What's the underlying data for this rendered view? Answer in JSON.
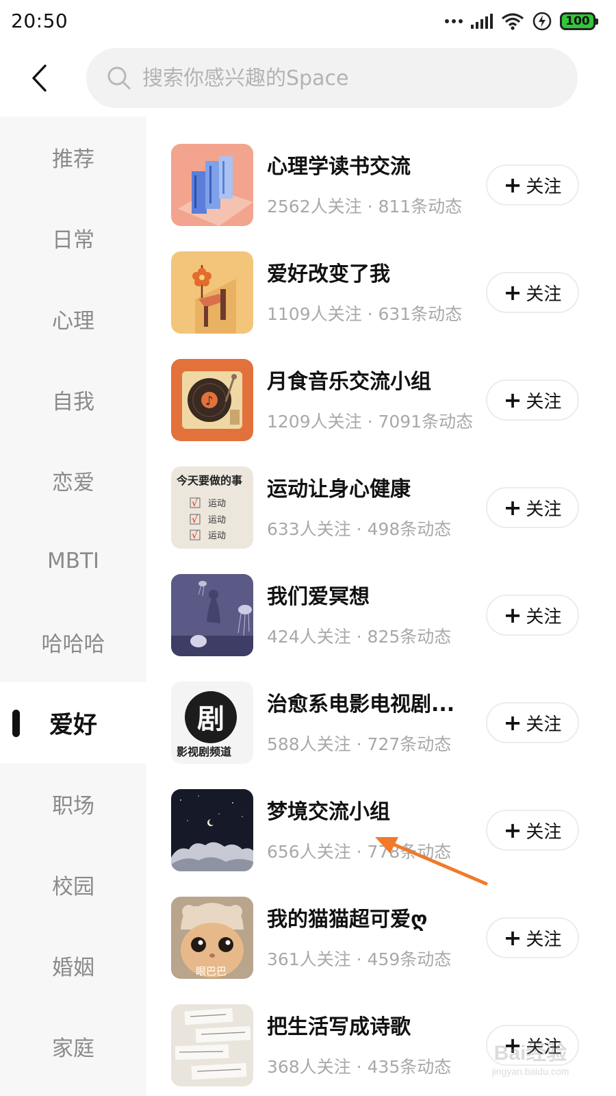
{
  "status_bar": {
    "time": "20:50",
    "battery": "100"
  },
  "header": {
    "search_placeholder": "搜索你感兴趣的Space"
  },
  "sidebar": {
    "items": [
      {
        "label": "推荐"
      },
      {
        "label": "日常"
      },
      {
        "label": "心理"
      },
      {
        "label": "自我"
      },
      {
        "label": "恋爱"
      },
      {
        "label": "MBTI"
      },
      {
        "label": "哈哈哈"
      },
      {
        "label": "爱好",
        "active": true
      },
      {
        "label": "职场"
      },
      {
        "label": "校园"
      },
      {
        "label": "婚姻"
      },
      {
        "label": "家庭"
      }
    ]
  },
  "follow_label": "关注",
  "spaces": [
    {
      "title": "心理学读书交流",
      "stats": "2562人关注 · 811条动态",
      "icon": "books-thumb"
    },
    {
      "title": "爱好改变了我",
      "stats": "1109人关注 · 631条动态",
      "icon": "flower-hand-thumb"
    },
    {
      "title": "月食音乐交流小组",
      "stats": "1209人关注 · 7091条动态",
      "icon": "record-player-thumb"
    },
    {
      "title": "运动让身心健康",
      "stats": "633人关注 · 498条动态",
      "icon": "todo-list-thumb",
      "thumb_text": {
        "heading": "今天要做的事",
        "items": [
          "运动",
          "运动",
          "运动"
        ]
      }
    },
    {
      "title": "我们爱冥想",
      "stats": "424人关注 · 825条动态",
      "icon": "jellyfish-thumb"
    },
    {
      "title": "治愈系电影电视剧...",
      "stats": "588人关注 · 727条动态",
      "icon": "drama-logo-thumb",
      "thumb_text": {
        "glyph": "剧",
        "caption": "影视剧频道"
      }
    },
    {
      "title": "梦境交流小组",
      "stats": "656人关注 · 778条动态",
      "icon": "night-cloud-thumb"
    },
    {
      "title": "我的猫猫超可爱ღ",
      "stats": "361人关注 · 459条动态",
      "icon": "cat-thumb",
      "thumb_text": {
        "caption": "眼巴巴"
      }
    },
    {
      "title": "把生活写成诗歌",
      "stats": "368人关注 · 435条动态",
      "icon": "notes-thumb"
    }
  ],
  "watermark": {
    "text": "Bai经验",
    "sub": "jingyan.baidu.com"
  },
  "colors": {
    "annotation_arrow": "#f07a2a",
    "active_text": "#111111",
    "inactive_text": "#8a8a8a"
  }
}
